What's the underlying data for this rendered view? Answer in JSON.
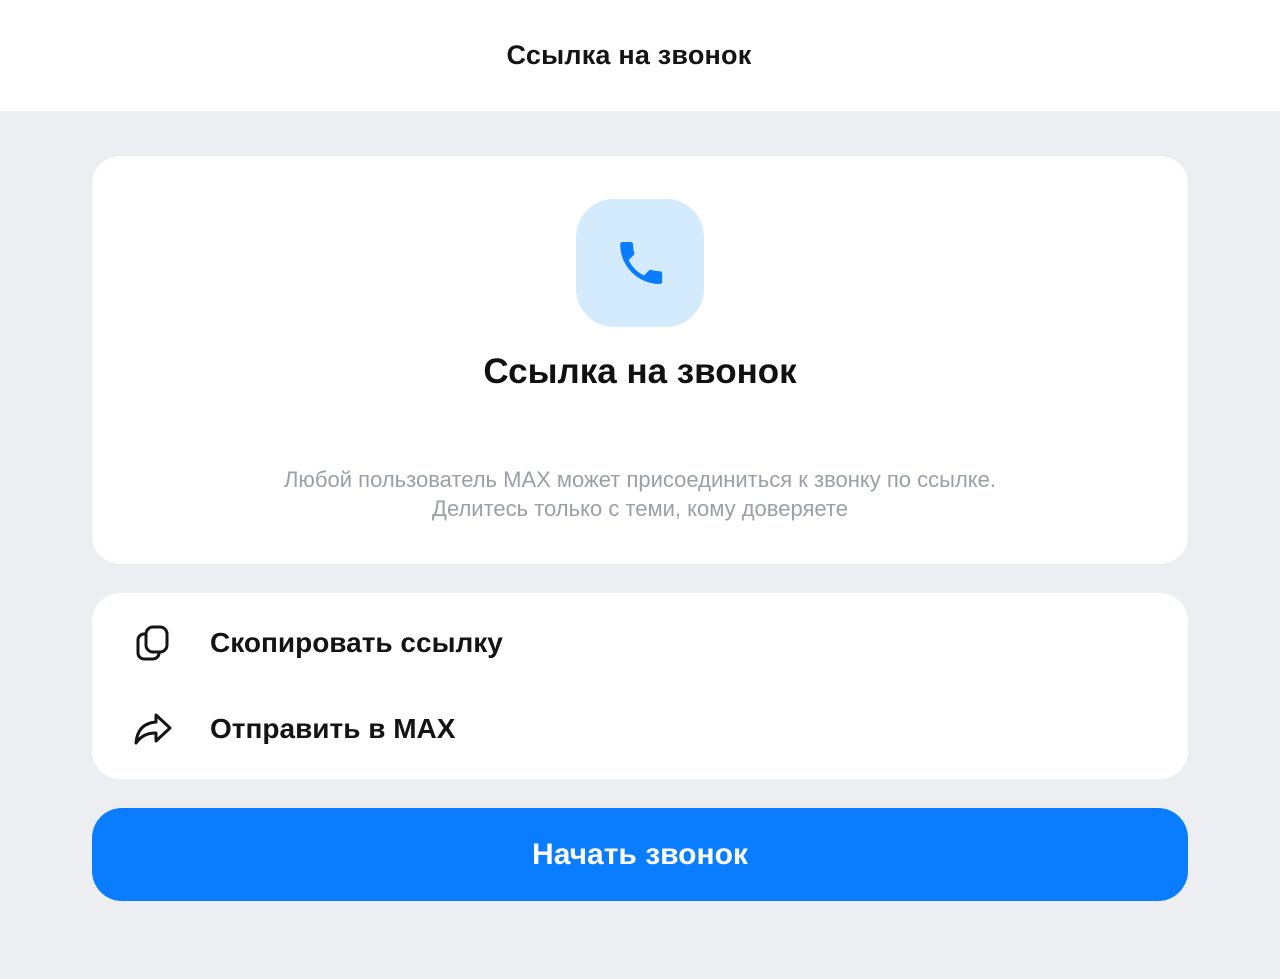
{
  "header": {
    "title": "Ссылка на звонок"
  },
  "info": {
    "icon": "phone-icon",
    "title": "Ссылка на звонок",
    "description_line1": "Любой пользователь MAX может присоединиться к звонку по ссылке.",
    "description_line2": "Делитесь только с теми, кому доверяете"
  },
  "actions": {
    "copy": {
      "label": "Скопировать ссылку",
      "icon": "copy-icon"
    },
    "share": {
      "label": "Отправить в MAX",
      "icon": "share-arrow-icon"
    }
  },
  "start_button": {
    "label": "Начать звонок"
  },
  "colors": {
    "accent": "#0a7dff",
    "icon_tile": "#d3ebfd",
    "background": "#eceef2",
    "muted_text": "#9b9fa6"
  }
}
